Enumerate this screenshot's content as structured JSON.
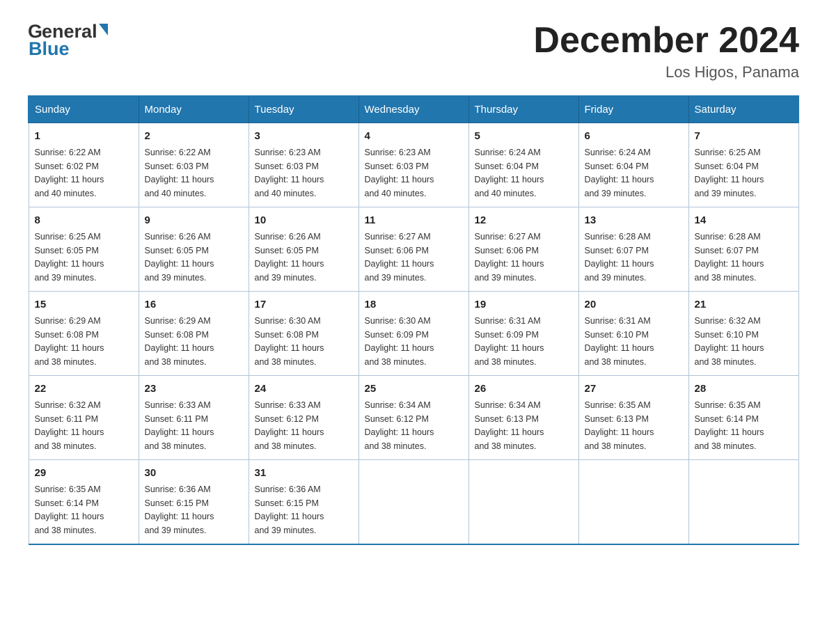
{
  "header": {
    "title": "December 2024",
    "subtitle": "Los Higos, Panama",
    "logo_general": "General",
    "logo_blue": "Blue"
  },
  "days_of_week": [
    "Sunday",
    "Monday",
    "Tuesday",
    "Wednesday",
    "Thursday",
    "Friday",
    "Saturday"
  ],
  "weeks": [
    [
      {
        "day": "1",
        "sunrise": "6:22 AM",
        "sunset": "6:02 PM",
        "daylight": "11 hours and 40 minutes."
      },
      {
        "day": "2",
        "sunrise": "6:22 AM",
        "sunset": "6:03 PM",
        "daylight": "11 hours and 40 minutes."
      },
      {
        "day": "3",
        "sunrise": "6:23 AM",
        "sunset": "6:03 PM",
        "daylight": "11 hours and 40 minutes."
      },
      {
        "day": "4",
        "sunrise": "6:23 AM",
        "sunset": "6:03 PM",
        "daylight": "11 hours and 40 minutes."
      },
      {
        "day": "5",
        "sunrise": "6:24 AM",
        "sunset": "6:04 PM",
        "daylight": "11 hours and 40 minutes."
      },
      {
        "day": "6",
        "sunrise": "6:24 AM",
        "sunset": "6:04 PM",
        "daylight": "11 hours and 39 minutes."
      },
      {
        "day": "7",
        "sunrise": "6:25 AM",
        "sunset": "6:04 PM",
        "daylight": "11 hours and 39 minutes."
      }
    ],
    [
      {
        "day": "8",
        "sunrise": "6:25 AM",
        "sunset": "6:05 PM",
        "daylight": "11 hours and 39 minutes."
      },
      {
        "day": "9",
        "sunrise": "6:26 AM",
        "sunset": "6:05 PM",
        "daylight": "11 hours and 39 minutes."
      },
      {
        "day": "10",
        "sunrise": "6:26 AM",
        "sunset": "6:05 PM",
        "daylight": "11 hours and 39 minutes."
      },
      {
        "day": "11",
        "sunrise": "6:27 AM",
        "sunset": "6:06 PM",
        "daylight": "11 hours and 39 minutes."
      },
      {
        "day": "12",
        "sunrise": "6:27 AM",
        "sunset": "6:06 PM",
        "daylight": "11 hours and 39 minutes."
      },
      {
        "day": "13",
        "sunrise": "6:28 AM",
        "sunset": "6:07 PM",
        "daylight": "11 hours and 39 minutes."
      },
      {
        "day": "14",
        "sunrise": "6:28 AM",
        "sunset": "6:07 PM",
        "daylight": "11 hours and 38 minutes."
      }
    ],
    [
      {
        "day": "15",
        "sunrise": "6:29 AM",
        "sunset": "6:08 PM",
        "daylight": "11 hours and 38 minutes."
      },
      {
        "day": "16",
        "sunrise": "6:29 AM",
        "sunset": "6:08 PM",
        "daylight": "11 hours and 38 minutes."
      },
      {
        "day": "17",
        "sunrise": "6:30 AM",
        "sunset": "6:08 PM",
        "daylight": "11 hours and 38 minutes."
      },
      {
        "day": "18",
        "sunrise": "6:30 AM",
        "sunset": "6:09 PM",
        "daylight": "11 hours and 38 minutes."
      },
      {
        "day": "19",
        "sunrise": "6:31 AM",
        "sunset": "6:09 PM",
        "daylight": "11 hours and 38 minutes."
      },
      {
        "day": "20",
        "sunrise": "6:31 AM",
        "sunset": "6:10 PM",
        "daylight": "11 hours and 38 minutes."
      },
      {
        "day": "21",
        "sunrise": "6:32 AM",
        "sunset": "6:10 PM",
        "daylight": "11 hours and 38 minutes."
      }
    ],
    [
      {
        "day": "22",
        "sunrise": "6:32 AM",
        "sunset": "6:11 PM",
        "daylight": "11 hours and 38 minutes."
      },
      {
        "day": "23",
        "sunrise": "6:33 AM",
        "sunset": "6:11 PM",
        "daylight": "11 hours and 38 minutes."
      },
      {
        "day": "24",
        "sunrise": "6:33 AM",
        "sunset": "6:12 PM",
        "daylight": "11 hours and 38 minutes."
      },
      {
        "day": "25",
        "sunrise": "6:34 AM",
        "sunset": "6:12 PM",
        "daylight": "11 hours and 38 minutes."
      },
      {
        "day": "26",
        "sunrise": "6:34 AM",
        "sunset": "6:13 PM",
        "daylight": "11 hours and 38 minutes."
      },
      {
        "day": "27",
        "sunrise": "6:35 AM",
        "sunset": "6:13 PM",
        "daylight": "11 hours and 38 minutes."
      },
      {
        "day": "28",
        "sunrise": "6:35 AM",
        "sunset": "6:14 PM",
        "daylight": "11 hours and 38 minutes."
      }
    ],
    [
      {
        "day": "29",
        "sunrise": "6:35 AM",
        "sunset": "6:14 PM",
        "daylight": "11 hours and 38 minutes."
      },
      {
        "day": "30",
        "sunrise": "6:36 AM",
        "sunset": "6:15 PM",
        "daylight": "11 hours and 39 minutes."
      },
      {
        "day": "31",
        "sunrise": "6:36 AM",
        "sunset": "6:15 PM",
        "daylight": "11 hours and 39 minutes."
      },
      null,
      null,
      null,
      null
    ]
  ],
  "labels": {
    "sunrise": "Sunrise:",
    "sunset": "Sunset:",
    "daylight": "Daylight:"
  }
}
